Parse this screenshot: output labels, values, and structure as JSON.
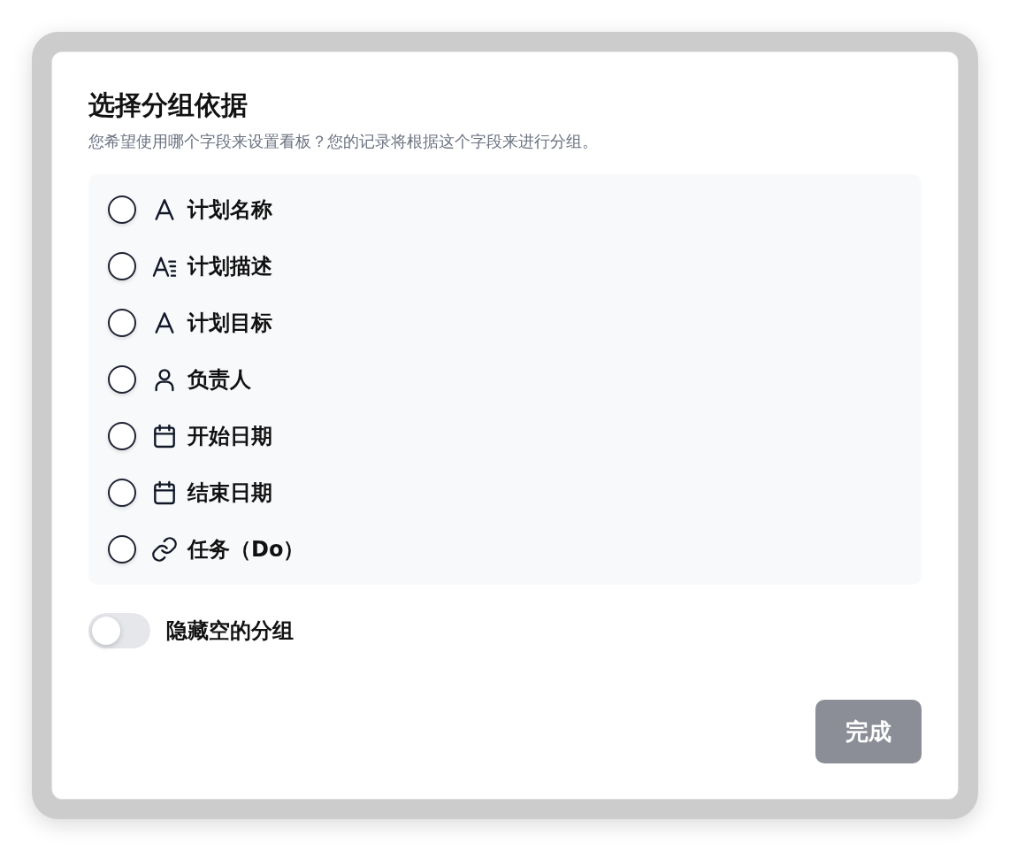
{
  "dialog": {
    "title": "选择分组依据",
    "description": "您希望使用哪个字段来设置看板？您的记录将根据这个字段来进行分组。"
  },
  "fields": [
    {
      "label": "计划名称",
      "kind": "text",
      "selected": false
    },
    {
      "label": "计划描述",
      "kind": "longtext",
      "selected": false
    },
    {
      "label": "计划目标",
      "kind": "text",
      "selected": false
    },
    {
      "label": "负责人",
      "kind": "person",
      "selected": false
    },
    {
      "label": "开始日期",
      "kind": "date",
      "selected": false
    },
    {
      "label": "结束日期",
      "kind": "date",
      "selected": false
    },
    {
      "label": "任务（Do）",
      "kind": "link",
      "selected": false
    }
  ],
  "hide_empty": {
    "label": "隐藏空的分组",
    "on": false
  },
  "done_button": {
    "label": "完成",
    "disabled": true
  }
}
